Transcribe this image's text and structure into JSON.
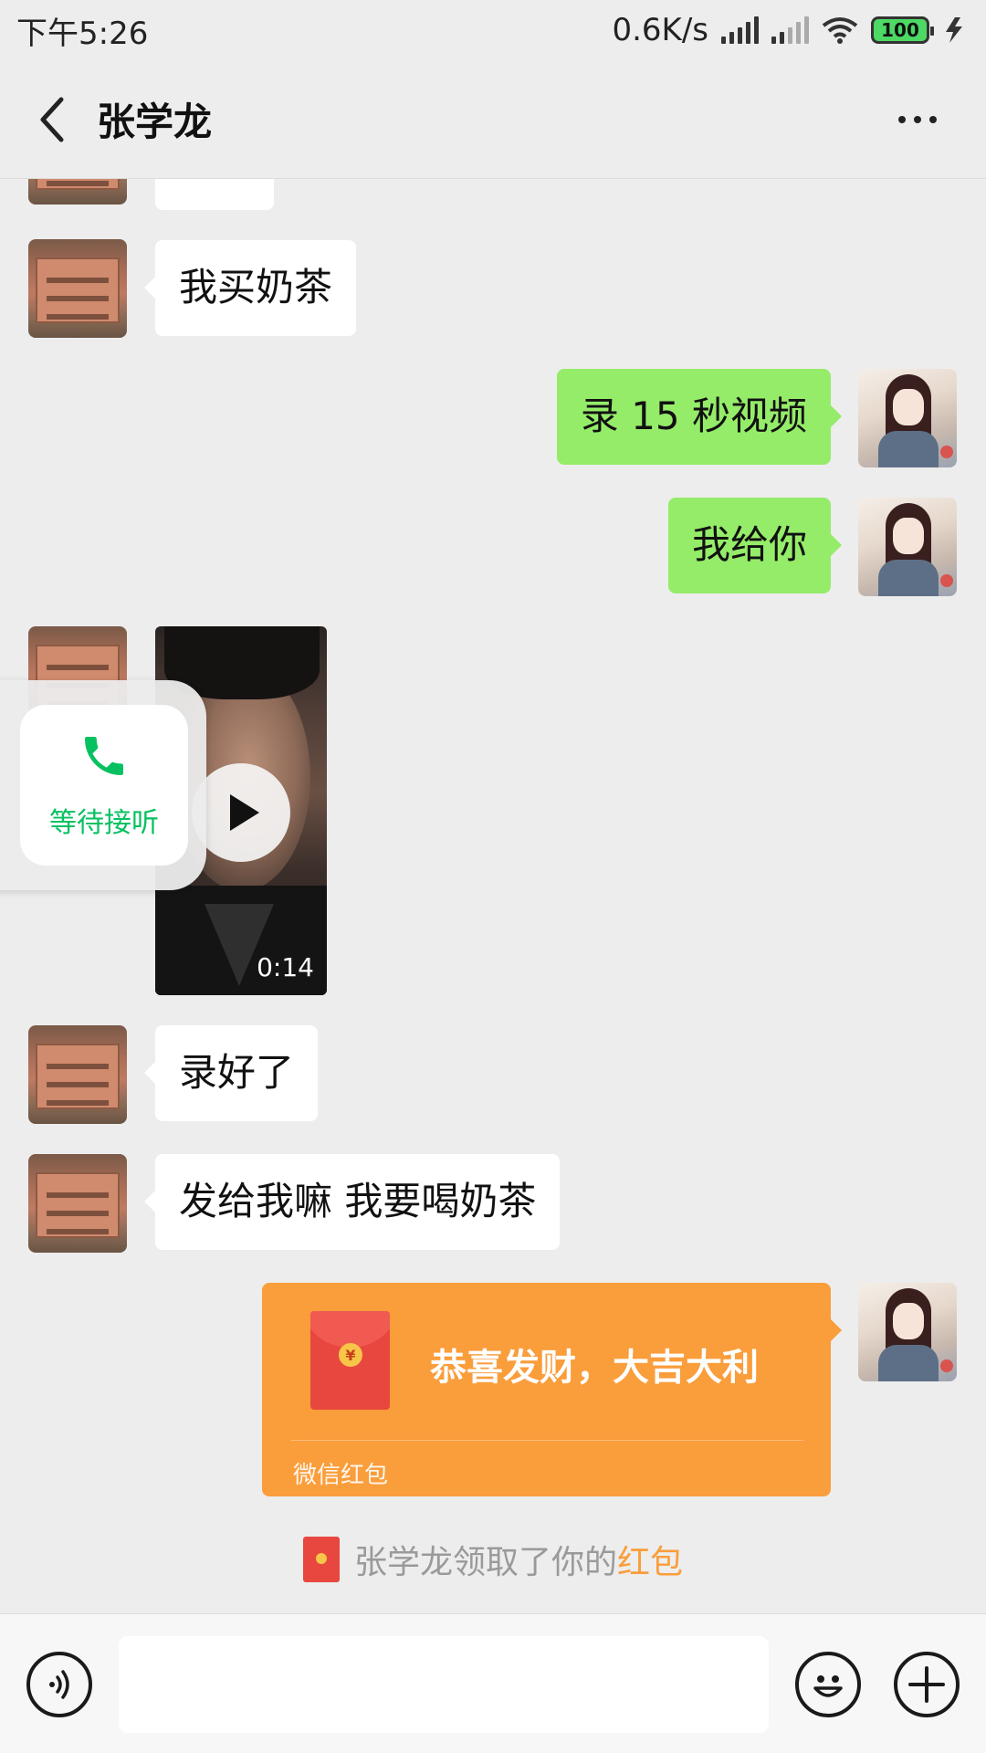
{
  "status": {
    "time": "下午5:26",
    "speed": "0.6K/s",
    "battery": "100"
  },
  "header": {
    "title": "张学龙"
  },
  "messages": {
    "m1": "我买奶茶",
    "m2": "录 15 秒视频",
    "m3": "我给你",
    "video_duration": "0:14",
    "m4": "录好了",
    "m5": "发给我嘛  我要喝奶茶"
  },
  "call_float": {
    "label": "等待接听"
  },
  "red_packet": {
    "wish": "恭喜发财，大吉大利",
    "footer": "微信红包"
  },
  "system_notice": {
    "text": "张学龙领取了你的",
    "link": "红包"
  },
  "input": {
    "value": ""
  },
  "colors": {
    "accent_green": "#07c160",
    "bubble_green": "#95ec69",
    "red_packet_orange": "#fa9d3b"
  }
}
